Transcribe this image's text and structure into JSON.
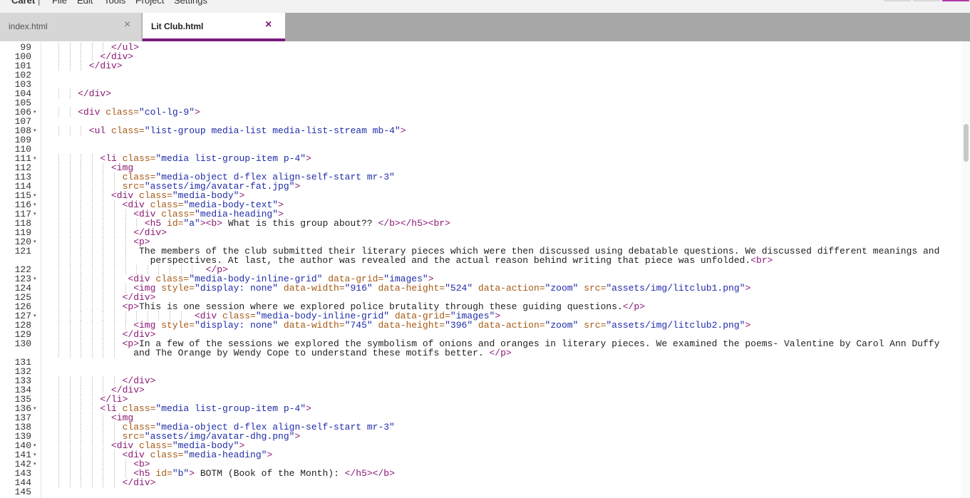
{
  "menu": {
    "brand": "Caret",
    "separator": "|",
    "items": [
      "File",
      "Edit",
      "Tools",
      "Project",
      "Settings"
    ]
  },
  "tabs": [
    {
      "label": "index.html",
      "close": "×",
      "active": false
    },
    {
      "label": "Lit Club.html",
      "close": "×",
      "active": true
    }
  ],
  "colors": {
    "accent": "#7a1a7e",
    "tag": "#8b1874",
    "attr": "#a65a16",
    "value": "#1f2ca8",
    "text": "#222222"
  },
  "editor": {
    "lines": [
      {
        "n": "99",
        "indent": 5,
        "segs": [
          [
            "t",
            "</ul>"
          ]
        ]
      },
      {
        "n": "100",
        "indent": 4,
        "segs": [
          [
            "t",
            "</div>"
          ]
        ]
      },
      {
        "n": "101",
        "indent": 3,
        "segs": [
          [
            "t",
            "</div>"
          ]
        ]
      },
      {
        "n": "102",
        "indent": 0,
        "segs": []
      },
      {
        "n": "103",
        "indent": 0,
        "segs": []
      },
      {
        "n": "104",
        "indent": 2,
        "segs": [
          [
            "t",
            "</div>"
          ]
        ]
      },
      {
        "n": "105",
        "indent": 0,
        "segs": []
      },
      {
        "n": "106",
        "fold": true,
        "indent": 2,
        "segs": [
          [
            "t",
            "<div "
          ],
          [
            "a",
            "class="
          ],
          [
            "v",
            "\"col-lg-9\""
          ],
          [
            "t",
            ">"
          ]
        ]
      },
      {
        "n": "107",
        "indent": 0,
        "segs": []
      },
      {
        "n": "108",
        "fold": true,
        "indent": 3,
        "segs": [
          [
            "t",
            "<ul "
          ],
          [
            "a",
            "class="
          ],
          [
            "v",
            "\"list-group media-list media-list-stream mb-4\""
          ],
          [
            "t",
            ">"
          ]
        ]
      },
      {
        "n": "109",
        "indent": 0,
        "segs": []
      },
      {
        "n": "110",
        "indent": 0,
        "segs": []
      },
      {
        "n": "111",
        "fold": true,
        "indent": 4,
        "segs": [
          [
            "t",
            "<li "
          ],
          [
            "a",
            "class="
          ],
          [
            "v",
            "\"media list-group-item p-4\""
          ],
          [
            "t",
            ">"
          ]
        ]
      },
      {
        "n": "112",
        "indent": 5,
        "segs": [
          [
            "t",
            "<img"
          ]
        ]
      },
      {
        "n": "113",
        "indent": 6,
        "segs": [
          [
            "a",
            "class="
          ],
          [
            "v",
            "\"media-object d-flex align-self-start mr-3\""
          ]
        ]
      },
      {
        "n": "114",
        "indent": 6,
        "segs": [
          [
            "a",
            "src="
          ],
          [
            "v",
            "\"assets/img/avatar-fat.jpg\""
          ],
          [
            "t",
            ">"
          ]
        ]
      },
      {
        "n": "115",
        "fold": true,
        "indent": 5,
        "segs": [
          [
            "t",
            "<div "
          ],
          [
            "a",
            "class="
          ],
          [
            "v",
            "\"media-body\""
          ],
          [
            "t",
            ">"
          ]
        ]
      },
      {
        "n": "116",
        "fold": true,
        "indent": 6,
        "segs": [
          [
            "t",
            "<div "
          ],
          [
            "a",
            "class="
          ],
          [
            "v",
            "\"media-body-text\""
          ],
          [
            "t",
            ">"
          ]
        ]
      },
      {
        "n": "117",
        "fold": true,
        "indent": 7,
        "segs": [
          [
            "t",
            "<div "
          ],
          [
            "a",
            "class="
          ],
          [
            "v",
            "\"media-heading\""
          ],
          [
            "t",
            ">"
          ]
        ]
      },
      {
        "n": "118",
        "indent": 8,
        "segs": [
          [
            "t",
            "<h5 "
          ],
          [
            "a",
            "id="
          ],
          [
            "v",
            "\"a\""
          ],
          [
            "t",
            "><b>"
          ],
          [
            "x",
            " What is this group about?? "
          ],
          [
            "t",
            "</b></h5><br>"
          ]
        ]
      },
      {
        "n": "119",
        "indent": 7,
        "segs": [
          [
            "t",
            "</div>"
          ]
        ]
      },
      {
        "n": "120",
        "fold": true,
        "indent": 7,
        "segs": [
          [
            "t",
            "<p>"
          ]
        ]
      },
      {
        "n": "121",
        "indent": 7,
        "pad": 1,
        "segs": [
          [
            "x",
            "The members of the club submitted their literary pieces which were then discussed using debatable questions. We discussed different meanings and"
          ]
        ]
      },
      {
        "n": "",
        "indent": 7,
        "pad": 3,
        "segs": [
          [
            "x",
            "perspectives. At last, the author was revealed and the actual reason behind writing that piece was unfolded."
          ],
          [
            "t",
            "<br>"
          ]
        ]
      },
      {
        "n": "122",
        "indent": 13,
        "pad": 1,
        "segs": [
          [
            "t",
            "</p>"
          ]
        ]
      },
      {
        "n": "123",
        "fold": true,
        "indent": 6,
        "pad": 1,
        "segs": [
          [
            "t",
            "<div "
          ],
          [
            "a",
            "class="
          ],
          [
            "v",
            "\"media-body-inline-grid\""
          ],
          [
            "a",
            " data-grid="
          ],
          [
            "v",
            "\"images\""
          ],
          [
            "t",
            ">"
          ]
        ]
      },
      {
        "n": "124",
        "indent": 7,
        "segs": [
          [
            "t",
            "<img "
          ],
          [
            "a",
            "style="
          ],
          [
            "v",
            "\"display: none\""
          ],
          [
            "a",
            " data-width="
          ],
          [
            "v",
            "\"916\""
          ],
          [
            "a",
            " data-height="
          ],
          [
            "v",
            "\"524\""
          ],
          [
            "a",
            " data-action="
          ],
          [
            "v",
            "\"zoom\""
          ],
          [
            "a",
            " src="
          ],
          [
            "v",
            "\"assets/img/litclub1.png\""
          ],
          [
            "t",
            ">"
          ]
        ]
      },
      {
        "n": "125",
        "indent": 6,
        "segs": [
          [
            "t",
            "</div>"
          ]
        ]
      },
      {
        "n": "126",
        "indent": 6,
        "segs": [
          [
            "t",
            "<p>"
          ],
          [
            "x",
            "This is one session where we explored police brutality through these guiding questions."
          ],
          [
            "t",
            "</p>"
          ]
        ]
      },
      {
        "n": "127",
        "fold": true,
        "indent": 12,
        "pad": 1,
        "segs": [
          [
            "t",
            "<div "
          ],
          [
            "a",
            "class="
          ],
          [
            "v",
            "\"media-body-inline-grid\""
          ],
          [
            "a",
            " data-grid="
          ],
          [
            "v",
            "\"images\""
          ],
          [
            "t",
            ">"
          ]
        ]
      },
      {
        "n": "128",
        "indent": 7,
        "segs": [
          [
            "t",
            "<img "
          ],
          [
            "a",
            "style="
          ],
          [
            "v",
            "\"display: none\""
          ],
          [
            "a",
            " data-width="
          ],
          [
            "v",
            "\"745\""
          ],
          [
            "a",
            " data-height="
          ],
          [
            "v",
            "\"396\""
          ],
          [
            "a",
            " data-action="
          ],
          [
            "v",
            "\"zoom\""
          ],
          [
            "a",
            " src="
          ],
          [
            "v",
            "\"assets/img/litclub2.png\""
          ],
          [
            "t",
            ">"
          ]
        ]
      },
      {
        "n": "129",
        "indent": 6,
        "segs": [
          [
            "t",
            "</div>"
          ]
        ]
      },
      {
        "n": "130",
        "indent": 6,
        "segs": [
          [
            "t",
            "<p>"
          ],
          [
            "x",
            "In a few of the sessions we explored the symbolism of onions and oranges in literary pieces. We examined the poems- Valentine by Carol Ann Duffy"
          ]
        ]
      },
      {
        "n": "",
        "indent": 6,
        "pad": 2,
        "segs": [
          [
            "x",
            "and The Orange by Wendy Cope to understand these motifs better. "
          ],
          [
            "t",
            "</p>"
          ]
        ]
      },
      {
        "n": "131",
        "indent": 0,
        "segs": []
      },
      {
        "n": "132",
        "indent": 0,
        "segs": []
      },
      {
        "n": "133",
        "indent": 6,
        "segs": [
          [
            "t",
            "</div>"
          ]
        ]
      },
      {
        "n": "134",
        "indent": 5,
        "segs": [
          [
            "t",
            "</div>"
          ]
        ]
      },
      {
        "n": "135",
        "indent": 4,
        "segs": [
          [
            "t",
            "</li>"
          ]
        ]
      },
      {
        "n": "136",
        "fold": true,
        "indent": 4,
        "segs": [
          [
            "t",
            "<li "
          ],
          [
            "a",
            "class="
          ],
          [
            "v",
            "\"media list-group-item p-4\""
          ],
          [
            "t",
            ">"
          ]
        ]
      },
      {
        "n": "137",
        "indent": 5,
        "segs": [
          [
            "t",
            "<img"
          ]
        ]
      },
      {
        "n": "138",
        "indent": 6,
        "segs": [
          [
            "a",
            "class="
          ],
          [
            "v",
            "\"media-object d-flex align-self-start mr-3\""
          ]
        ]
      },
      {
        "n": "139",
        "indent": 6,
        "segs": [
          [
            "a",
            "src="
          ],
          [
            "v",
            "\"assets/img/avatar-dhg.png\""
          ],
          [
            "t",
            ">"
          ]
        ]
      },
      {
        "n": "140",
        "fold": true,
        "indent": 5,
        "segs": [
          [
            "t",
            "<div "
          ],
          [
            "a",
            "class="
          ],
          [
            "v",
            "\"media-body\""
          ],
          [
            "t",
            ">"
          ]
        ]
      },
      {
        "n": "141",
        "fold": true,
        "indent": 6,
        "segs": [
          [
            "t",
            "<div "
          ],
          [
            "a",
            "class="
          ],
          [
            "v",
            "\"media-heading\""
          ],
          [
            "t",
            ">"
          ]
        ]
      },
      {
        "n": "142",
        "fold": true,
        "indent": 7,
        "segs": [
          [
            "t",
            "<b>"
          ]
        ]
      },
      {
        "n": "143",
        "indent": 7,
        "segs": [
          [
            "t",
            "<h5 "
          ],
          [
            "a",
            "id="
          ],
          [
            "v",
            "\"b\""
          ],
          [
            "t",
            ">"
          ],
          [
            "x",
            " BOTM (Book of the Month): "
          ],
          [
            "t",
            "</h5></b>"
          ]
        ]
      },
      {
        "n": "144",
        "indent": 6,
        "segs": [
          [
            "t",
            "</div>"
          ]
        ]
      },
      {
        "n": "145",
        "indent": 0,
        "segs": []
      }
    ]
  }
}
